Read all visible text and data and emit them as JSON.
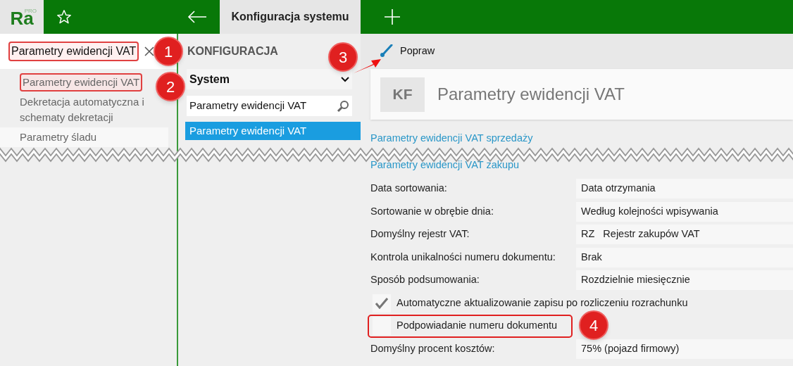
{
  "app": {
    "logo": "Ra",
    "logo_badge": "PRO"
  },
  "tabs": [
    {
      "label": "Konfiguracja systemu",
      "selected": true
    }
  ],
  "open_item": {
    "label": "Parametry ewidencji VAT"
  },
  "nav_items": [
    {
      "label": "Parametry ewidencji VAT"
    },
    {
      "label": "Dekretacja automatyczna i schematy dekretacji"
    },
    {
      "label": "Parametry śladu"
    }
  ],
  "config": {
    "title": "KONFIGURACJA",
    "category": "System",
    "search_value": "Parametry ewidencji VAT",
    "items": [
      {
        "label": "Parametry ewidencji VAT",
        "selected": true
      }
    ]
  },
  "toolbar": {
    "edit_label": "Popraw"
  },
  "header": {
    "badge": "KF",
    "title": "Parametry ewidencji VAT"
  },
  "sections": [
    {
      "title": "Parametry ewidencji VAT sprzedaży"
    },
    {
      "title": "Parametry ewidencji VAT zakupu",
      "rows": [
        {
          "kind": "field",
          "label": "Data sortowania:",
          "value": "Data otrzymania"
        },
        {
          "kind": "field",
          "label": "Sortowanie w obrębie dnia:",
          "value": "Według kolejności wpisywania"
        },
        {
          "kind": "field",
          "label": "Domyślny rejestr VAT:",
          "code": "RZ",
          "value": "Rejestr zakupów VAT"
        },
        {
          "kind": "field",
          "label": "Kontrola unikalności numeru dokumentu:",
          "value": "Brak"
        },
        {
          "kind": "field",
          "label": "Sposób podsumowania:",
          "value": "Rozdzielnie miesięcznie"
        },
        {
          "kind": "checkbox",
          "label": "Automatyczne aktualizowanie zapisu po rozliczeniu rozrachunku",
          "checked": true
        },
        {
          "kind": "checkbox",
          "label": "Podpowiadanie numeru dokumentu",
          "checked": false
        },
        {
          "kind": "field",
          "label": "Domyślny procent kosztów:",
          "value": "75% (pojazd firmowy)"
        }
      ]
    }
  ],
  "annotations": [
    {
      "number": "1"
    },
    {
      "number": "2"
    },
    {
      "number": "3"
    },
    {
      "number": "4"
    }
  ]
}
